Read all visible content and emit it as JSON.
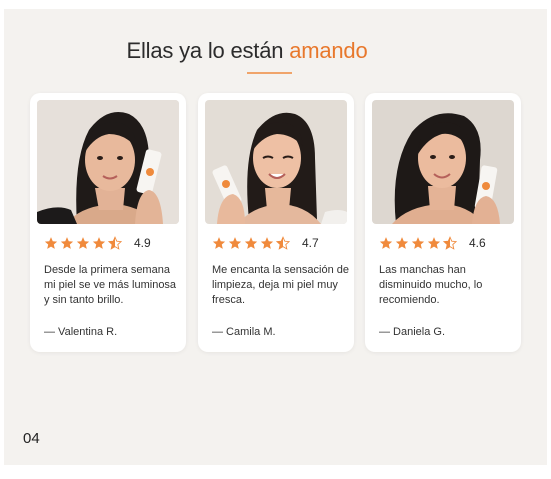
{
  "heading": {
    "text": "Ellas ya lo están",
    "accent": "amando"
  },
  "colors": {
    "accent": "#e8782c",
    "star": "#f08a3c",
    "background": "#f4f2ef",
    "card": "#ffffff"
  },
  "testimonials": [
    {
      "rating": "4.9",
      "rating_value": 4.5,
      "text": "Desde la primera semana mi piel se ve más luminosa y sin tanto brillo.",
      "author": "— Valentina R."
    },
    {
      "rating": "4.7",
      "rating_value": 4.5,
      "text": "Me encanta la sensación de limpieza, deja mi piel muy fresca.",
      "author": "— Camila M."
    },
    {
      "rating": "4.6",
      "rating_value": 4.5,
      "text": "Las manchas han disminuido mucho, lo recomiendo.",
      "author": "— Daniela G."
    }
  ],
  "page_number": "04"
}
